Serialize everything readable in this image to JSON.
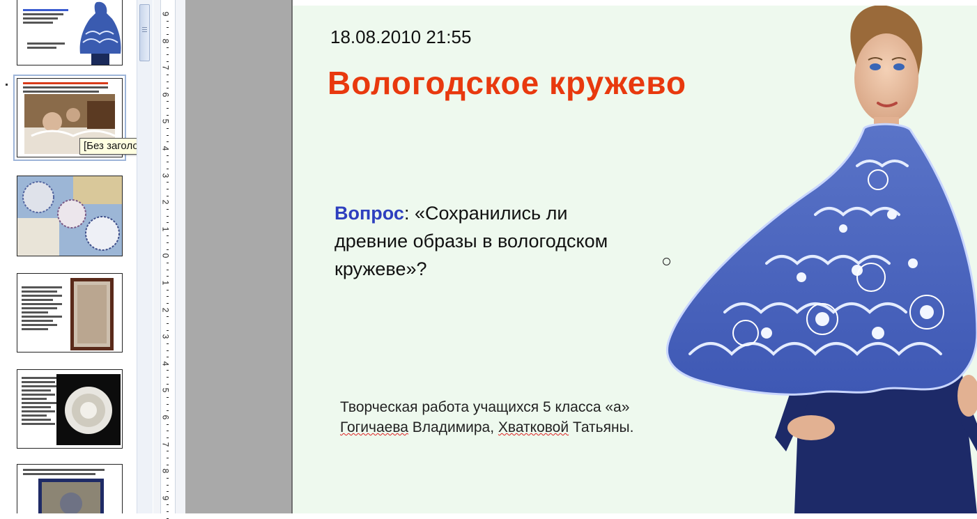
{
  "thumbnails": {
    "items": [
      {
        "id": "slide-1"
      },
      {
        "id": "slide-2",
        "selected": true
      },
      {
        "id": "slide-3"
      },
      {
        "id": "slide-4"
      },
      {
        "id": "slide-5"
      },
      {
        "id": "slide-6"
      }
    ],
    "tooltip": "[Без заголовка]"
  },
  "ruler": {
    "labels": [
      "9",
      "8",
      "7",
      "6",
      "5",
      "4",
      "3",
      "2",
      "1",
      "0",
      "1",
      "2",
      "3",
      "4",
      "5",
      "6",
      "7",
      "8",
      "9"
    ]
  },
  "slide": {
    "date": "18.08.2010 21:55",
    "title": "Вологодское кружево",
    "question_label": "Вопрос",
    "question_text": ": «Сохранились ли древние образы в вологодском кружеве»?",
    "credit_line1": "Творческая работа учащихся 5 класса «а»",
    "credit_word1": "Гогичаева",
    "credit_middle": " Владимира, ",
    "credit_word2": "Хватковой",
    "credit_end": " Татьяны."
  },
  "colors": {
    "title": "#e8390e",
    "question_label": "#2e3fbf",
    "slide_background": "#eef9ee"
  }
}
